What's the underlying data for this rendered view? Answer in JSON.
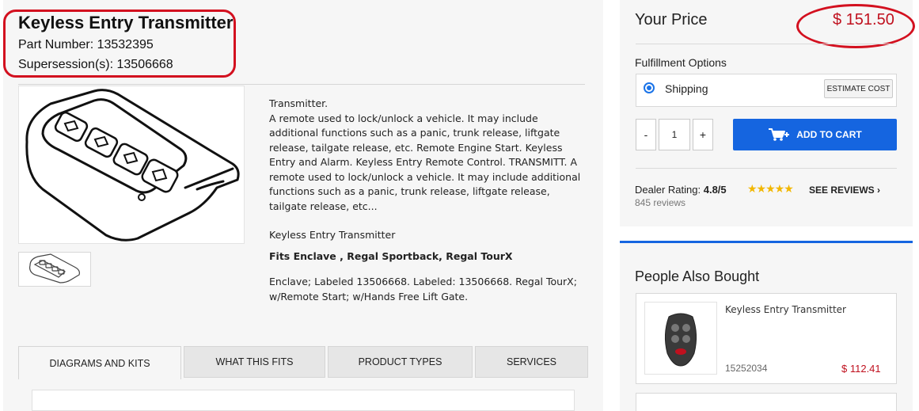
{
  "product": {
    "title": "Keyless Entry Transmitter",
    "part_number": "Part Number: 13532395",
    "supersession": "Supersession(s): 13506668"
  },
  "description": {
    "main": "Transmitter.\nA remote used to lock/unlock a vehicle. It may include additional functions such as a panic, trunk release, liftgate release, tailgate release, etc. Remote Engine Start. Keyless Entry and Alarm. Keyless Entry Remote Control. TRANSMITT. A remote used to lock/unlock a vehicle. It may include additional functions such as a panic, trunk release, liftgate release, tailgate release, etc...",
    "subtitle": "Keyless Entry Transmitter",
    "fits": "Fits Enclave , Regal Sportback, Regal TourX",
    "notes": "Enclave; Labeled 13506668. Labeled: 13506668. Regal TourX; w/Remote Start; w/Hands Free Lift Gate."
  },
  "tabs": [
    {
      "label": "DIAGRAMS AND KITS",
      "active": true
    },
    {
      "label": "WHAT THIS FITS",
      "active": false
    },
    {
      "label": "PRODUCT TYPES",
      "active": false
    },
    {
      "label": "SERVICES",
      "active": false
    }
  ],
  "pricing": {
    "label": "Your Price",
    "price": "$ 151.50"
  },
  "fulfillment": {
    "label": "Fulfillment Options",
    "shipping_label": "Shipping",
    "estimate_label": "ESTIMATE COST"
  },
  "cart": {
    "minus": "-",
    "quantity": "1",
    "plus": "+",
    "add_label": "ADD TO CART"
  },
  "dealer": {
    "rating_label": "Dealer Rating:",
    "rating_value": "4.8/5",
    "stars": "★★★★★",
    "see_reviews": "SEE REVIEWS ›",
    "review_count": "845 reviews"
  },
  "people_also_bought": {
    "title": "People Also Bought",
    "items": [
      {
        "name": "Keyless Entry Transmitter",
        "part_number": "15252034",
        "price": "$ 112.41"
      }
    ]
  },
  "colors": {
    "accent_blue": "#1565e0",
    "price_red": "#c0101e",
    "highlight_red": "#d3101f",
    "star_gold": "#f2b700"
  },
  "icons": {
    "cart": "cart-plus-icon",
    "radio": "radio-selected-icon"
  }
}
